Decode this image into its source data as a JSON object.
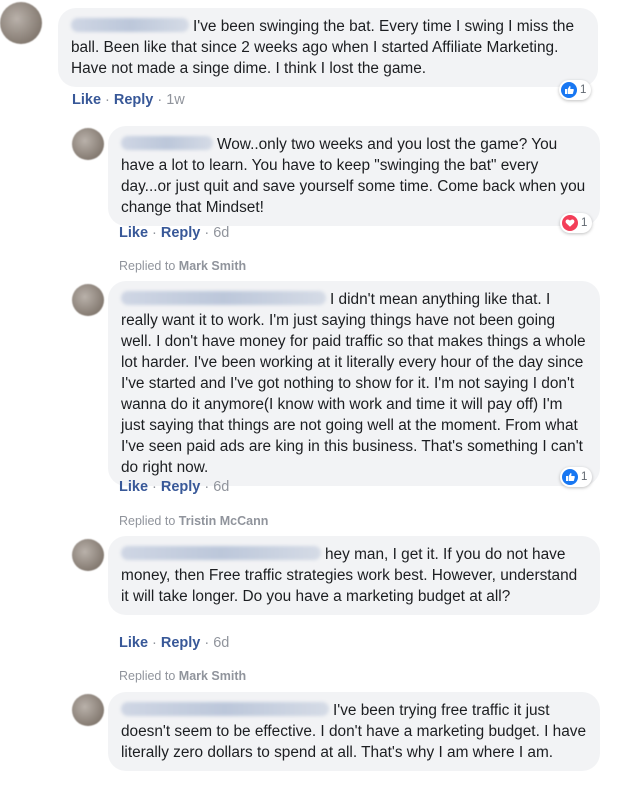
{
  "comments": [
    {
      "text": "I've been swinging the bat. Every time I swing I miss the ball. Been like that since 2 weeks ago when I started Affiliate Marketing. Have not made a singe dime. I think I lost the game.",
      "actions": {
        "like": "Like",
        "reply": "Reply",
        "time": "1w"
      },
      "reaction": {
        "icon": "thumbs-up-icon",
        "count": "1",
        "color": "#1877f2"
      }
    },
    {
      "text": "Wow..only two weeks and you lost the game? You have a lot to learn. You have to keep \"swinging the bat\" every day...or just quit and save yourself some time. Come back when you change that Mindset!",
      "actions": {
        "like": "Like",
        "reply": "Reply",
        "time": "6d"
      },
      "reaction": {
        "icon": "heart-icon",
        "count": "1",
        "color": "#f33e58"
      }
    },
    {
      "replied_prefix": "Replied to",
      "replied_name": "Mark Smith",
      "text": "I didn't mean anything like that. I really want it to work. I'm just saying things have not been going well. I don't have money for paid traffic so that makes things a whole lot harder. I've been working at it literally every hour of the day since I've started and I've got nothing to show for it. I'm not saying I don't wanna do it anymore(I know with work and time it will pay off) I'm just saying that things are not going well at the moment. From what I've seen paid ads are king in this business. That's something I can't do right now.",
      "actions": {
        "like": "Like",
        "reply": "Reply",
        "time": "6d"
      },
      "reaction": {
        "icon": "thumbs-up-icon",
        "count": "1",
        "color": "#1877f2"
      }
    },
    {
      "replied_prefix": "Replied to",
      "replied_name": "Tristin McCann",
      "text": "hey man, I get it. If you do not have money, then Free traffic strategies work best. However, understand it will take longer. Do you have a marketing budget at all?",
      "actions": {
        "like": "Like",
        "reply": "Reply",
        "time": "6d"
      }
    },
    {
      "replied_prefix": "Replied to",
      "replied_name": "Mark Smith",
      "text": "I've been trying free traffic it just doesn't seem to be effective. I don't have a marketing budget. I have literally zero dollars to spend at all. That's why I am where I am."
    }
  ]
}
